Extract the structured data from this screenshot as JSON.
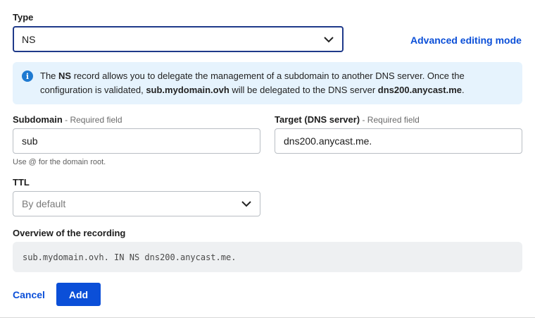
{
  "type_field": {
    "label": "Type",
    "value": "NS"
  },
  "advanced_link": "Advanced editing mode",
  "info": {
    "t1": "The ",
    "t2": "NS",
    "t3": " record allows you to delegate the management of a subdomain to another DNS server. Once the configuration is validated, ",
    "t4": "sub.mydomain.ovh",
    "t5": " will be delegated to the DNS server ",
    "t6": "dns200.anycast.me",
    "t7": "."
  },
  "subdomain": {
    "label": "Subdomain",
    "required": " - Required field",
    "value": "sub",
    "hint": "Use @ for the domain root."
  },
  "target": {
    "label": "Target (DNS server)",
    "required": " - Required field",
    "value": "dns200.anycast.me."
  },
  "ttl": {
    "label": "TTL",
    "placeholder": "By default"
  },
  "overview": {
    "label": "Overview of the recording",
    "value": "sub.mydomain.ovh. IN NS dns200.anycast.me."
  },
  "actions": {
    "cancel": "Cancel",
    "add": "Add"
  },
  "colors": {
    "accent": "#0b4fd8",
    "info_bg": "#e6f3fd",
    "info_icon": "#1f7ad1",
    "focus_border": "#1f3a8a"
  },
  "icons": {
    "select_arrow": "chevron-down-icon",
    "info": "info-icon"
  }
}
